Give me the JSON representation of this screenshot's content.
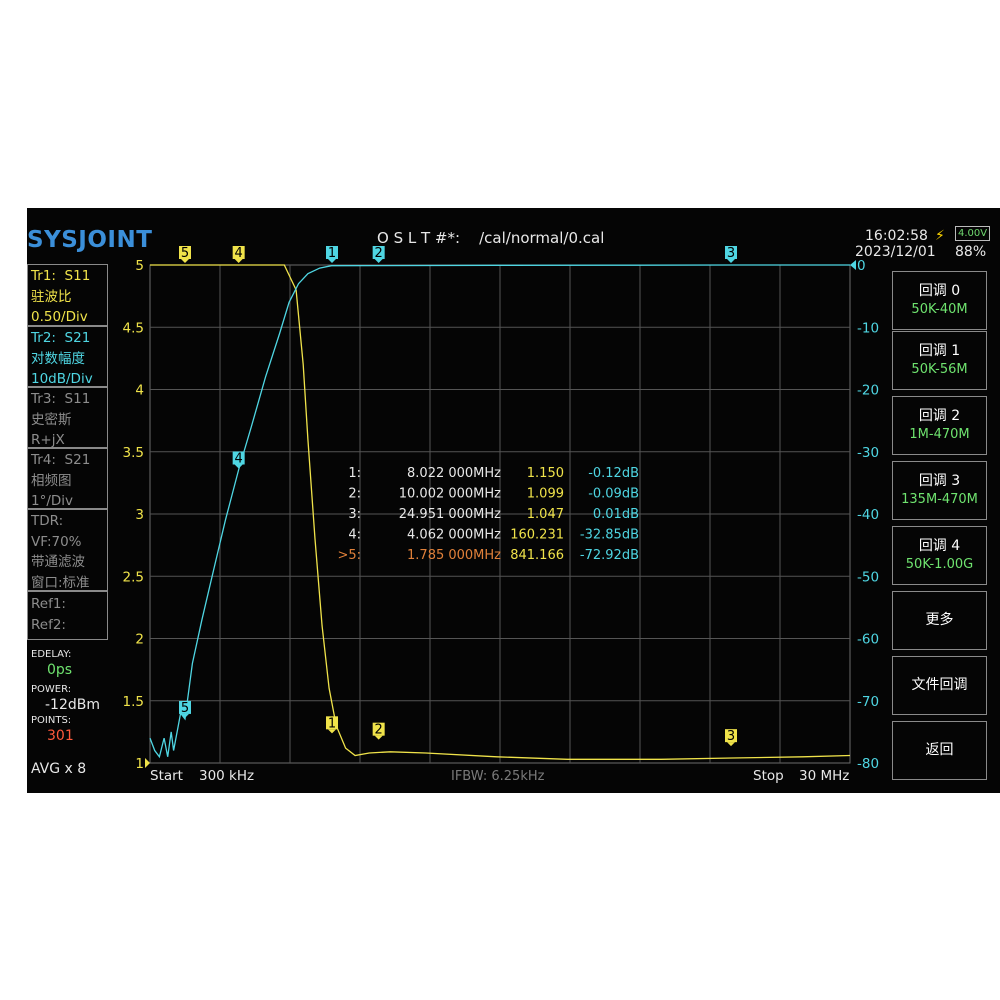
{
  "header": {
    "logo": "SYSJOINT",
    "cal_path": "O S L T #*:    /cal/normal/0.cal",
    "time": "16:02:58",
    "date": "2023/12/01",
    "battery_voltage": "4.00V",
    "battery_percent": "88%",
    "battery_icon": "lightning-icon"
  },
  "traces": [
    {
      "id": "Tr1:",
      "param": "S11",
      "format": "驻波比",
      "scale": "0.50/Div",
      "color": "#f0e34a",
      "active": true
    },
    {
      "id": "Tr2:",
      "param": "S21",
      "format": "对数幅度",
      "scale": "10dB/Div",
      "color": "#4fd6e3",
      "active": true
    },
    {
      "id": "Tr3:",
      "param": "S11",
      "format": "史密斯",
      "scale": "R+jX",
      "color": "#8d8d8d",
      "active": false
    },
    {
      "id": "Tr4:",
      "param": "S21",
      "format": "相频图",
      "scale": "1°/Div",
      "color": "#8d8d8d",
      "active": false
    }
  ],
  "tdr": {
    "title": "TDR:",
    "vf": "VF:70%",
    "mode": "带通滤波",
    "window": "窗口:标准"
  },
  "refs": {
    "ref1": "Ref1:",
    "ref2": "Ref2:"
  },
  "settings": {
    "edelay_label": "EDELAY:",
    "edelay_value": "0ps",
    "power_label": "POWER:",
    "power_value": "-12dBm",
    "points_label": "POINTS:",
    "points_value": "301",
    "avg": "AVG x 8"
  },
  "softkeys": [
    {
      "label": "回调 0",
      "sub": "50K-40M"
    },
    {
      "label": "回调 1",
      "sub": "50K-56M"
    },
    {
      "label": "回调 2",
      "sub": "1M-470M"
    },
    {
      "label": "回调 3",
      "sub": "135M-470M"
    },
    {
      "label": "回调 4",
      "sub": "50K-1.00G"
    },
    {
      "label": "更多",
      "sub": ""
    },
    {
      "label": "文件回调",
      "sub": ""
    },
    {
      "label": "返回",
      "sub": ""
    }
  ],
  "sweep": {
    "start_label": "Start",
    "start_value": "300 kHz",
    "stop_label": "Stop",
    "stop_value": "30 MHz",
    "ifbw": "IFBW: 6.25kHz"
  },
  "markers_table": [
    {
      "id": "1:",
      "freq": "8.022 000MHz",
      "swr": "1.150",
      "db": "-0.12dB",
      "active": false
    },
    {
      "id": "2:",
      "freq": "10.002 000MHz",
      "swr": "1.099",
      "db": "-0.09dB",
      "active": false
    },
    {
      "id": "3:",
      "freq": "24.951 000MHz",
      "swr": "1.047",
      "db": "0.01dB",
      "active": false
    },
    {
      "id": "4:",
      "freq": "4.062 000MHz",
      "swr": "160.231",
      "db": "-32.85dB",
      "active": false
    },
    {
      "id": ">5:",
      "freq": "1.785 000MHz",
      "swr": "841.166",
      "db": "-72.92dB",
      "active": true
    }
  ],
  "chart_data": {
    "type": "line",
    "x_range_mhz": [
      0.3,
      30
    ],
    "y_left": {
      "label": "SWR",
      "ticks": [
        "5",
        "4.5",
        "4",
        "3.5",
        "3",
        "2.5",
        "2",
        "1.5",
        "1"
      ],
      "ylim": [
        1,
        5
      ]
    },
    "y_right": {
      "label": "dB",
      "ticks": [
        "0",
        "-10",
        "-20",
        "-30",
        "-40",
        "-50",
        "-60",
        "-70",
        "-80"
      ],
      "ylim": [
        -80,
        0
      ]
    },
    "grid": true,
    "series": [
      {
        "color": "#f0e34a",
        "x": [
          0.3,
          6.0,
          6.5,
          6.8,
          7.0,
          7.3,
          7.6,
          7.9,
          8.2,
          8.6,
          9.0,
          9.6,
          10.5,
          12,
          15,
          18,
          22,
          25,
          28,
          30
        ],
        "y": [
          5,
          5,
          4.8,
          4.2,
          3.6,
          2.8,
          2.1,
          1.6,
          1.3,
          1.12,
          1.06,
          1.08,
          1.09,
          1.08,
          1.05,
          1.03,
          1.03,
          1.04,
          1.05,
          1.06
        ]
      },
      {
        "color": "#4fd6e3",
        "x": [
          0.3,
          0.5,
          0.7,
          0.9,
          1.05,
          1.2,
          1.3,
          1.5,
          1.6,
          1.785,
          2.1,
          2.5,
          3.0,
          3.5,
          4.062,
          4.6,
          5.2,
          5.8,
          6.2,
          6.6,
          7.0,
          7.5,
          8.0,
          10,
          15,
          20,
          25,
          30
        ],
        "y": [
          -76,
          -78,
          -79,
          -76,
          -79,
          -75,
          -78,
          -74,
          -72,
          -72.92,
          -64,
          -57,
          -49,
          -41,
          -32.85,
          -26,
          -18,
          -11,
          -6,
          -3,
          -1.4,
          -0.5,
          -0.12,
          -0.09,
          -0.05,
          -0.03,
          0.01,
          0
        ]
      }
    ]
  },
  "chart_markers": [
    {
      "label": "1",
      "x": 8.022,
      "y_left": 1.15,
      "y_right": -0.12
    },
    {
      "label": "2",
      "x": 10.002,
      "y_left": 1.099,
      "y_right": -0.09
    },
    {
      "label": "3",
      "x": 24.951,
      "y_left": 1.047,
      "y_right": 0.01
    },
    {
      "label": "4",
      "x": 4.062,
      "y_left": 5,
      "y_right": -32.85
    },
    {
      "label": "5",
      "x": 1.785,
      "y_left": 5,
      "y_right": -72.92
    }
  ]
}
